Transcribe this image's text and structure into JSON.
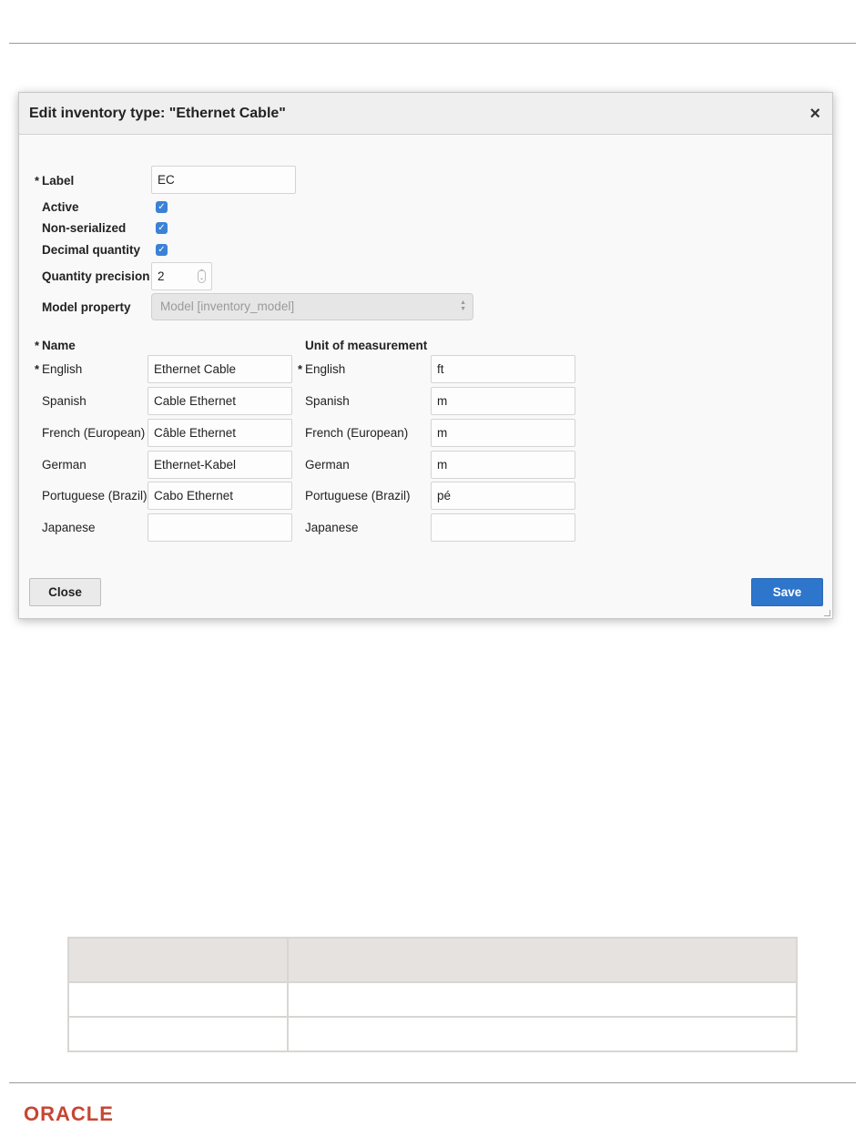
{
  "dialog": {
    "title": "Edit inventory type: \"Ethernet Cable\"",
    "close_icon": "×",
    "required_mark": "*",
    "fields": {
      "label": {
        "label": "Label",
        "value": "EC"
      },
      "active": {
        "label": "Active",
        "checked": true
      },
      "non_serialized": {
        "label": "Non-serialized",
        "checked": true
      },
      "decimal_quantity": {
        "label": "Decimal quantity",
        "checked": true
      },
      "quantity_precision": {
        "label": "Quantity precision",
        "value": "2"
      },
      "model_property": {
        "label": "Model property",
        "value": "Model [inventory_model]"
      }
    },
    "name_section": {
      "heading": "Name",
      "rows": [
        {
          "lang": "English",
          "value": "Ethernet Cable"
        },
        {
          "lang": "Spanish",
          "value": "Cable Ethernet"
        },
        {
          "lang": "French (European)",
          "value": "Câble Ethernet"
        },
        {
          "lang": "German",
          "value": "Ethernet-Kabel"
        },
        {
          "lang": "Portuguese (Brazil)",
          "value": "Cabo Ethernet"
        },
        {
          "lang": "Japanese",
          "value": ""
        }
      ]
    },
    "uom_section": {
      "heading": "Unit of measurement",
      "rows": [
        {
          "lang": "English",
          "value": "ft"
        },
        {
          "lang": "Spanish",
          "value": "m"
        },
        {
          "lang": "French (European)",
          "value": "m"
        },
        {
          "lang": "German",
          "value": "m"
        },
        {
          "lang": "Portuguese (Brazil)",
          "value": "pé"
        },
        {
          "lang": "Japanese",
          "value": ""
        }
      ]
    },
    "buttons": {
      "close": "Close",
      "save": "Save"
    }
  },
  "footer": {
    "logo": "ORACLE"
  },
  "colors": {
    "primary": "#2e75cc",
    "checkbox": "#3b82d6",
    "brand": "#c74634"
  }
}
